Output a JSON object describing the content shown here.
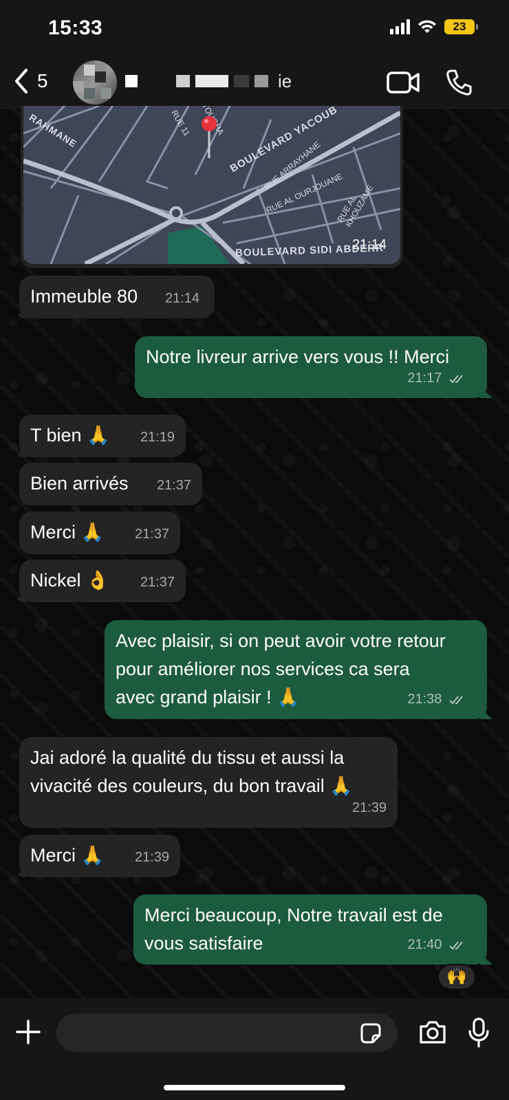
{
  "status_bar": {
    "time": "15:33",
    "battery": "23"
  },
  "header": {
    "back_count": "5",
    "contact_name_visible": "ie"
  },
  "map": {
    "labels": [
      "RAHMANE",
      "RUE 11",
      "TOUGHA",
      "BOULEVARD YACOUB",
      "RUE ARRAYHANE",
      "RUE AL OURJOUANE",
      "RUE AL KHOUZAME",
      "RUE AL",
      "BOULEVARD SIDI ABDERR"
    ],
    "time": "21:14"
  },
  "messages": [
    {
      "dir": "in",
      "text": "Immeuble 80",
      "time": "21:14"
    },
    {
      "dir": "out",
      "text": "Notre livreur arrive vers vous !! Merci",
      "time": "21:17"
    },
    {
      "dir": "in",
      "text": "T bien 🙏",
      "time": "21:19"
    },
    {
      "dir": "in",
      "text": "Bien arrivés",
      "time": "21:37"
    },
    {
      "dir": "in",
      "text": "Merci 🙏",
      "time": "21:37"
    },
    {
      "dir": "in",
      "text": "Nickel 👌",
      "time": "21:37"
    },
    {
      "dir": "out",
      "lines": [
        "Avec plaisir, si on peut avoir votre retour",
        "pour améliorer nos services ca sera",
        "avec grand plaisir ! 🙏"
      ],
      "time": "21:38"
    },
    {
      "dir": "in",
      "lines": [
        "Jai adoré la qualité du tissu et aussi la",
        "vivacité des couleurs, du bon travail 🙏"
      ],
      "time": "21:39"
    },
    {
      "dir": "in",
      "text": "Merci 🙏",
      "time": "21:39"
    },
    {
      "dir": "out",
      "lines": [
        "Merci beaucoup, Notre travail est de",
        "vous satisfaire"
      ],
      "time": "21:40"
    }
  ],
  "reaction": "🙌",
  "input": {
    "placeholder": ""
  },
  "colors": {
    "incoming": "#242424",
    "outgoing": "#1c5b3d",
    "battery": "#f5c518",
    "map": "#3f4656",
    "pin": "#e8323c"
  },
  "icons": [
    "chevron-left-icon",
    "video-camera-icon",
    "phone-icon",
    "plus-icon",
    "sticker-icon",
    "camera-icon",
    "microphone-icon",
    "double-check-icon",
    "location-pin-icon"
  ]
}
